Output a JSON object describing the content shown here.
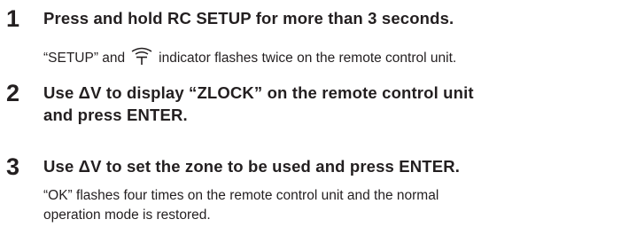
{
  "steps": [
    {
      "number": "1",
      "title": "Press and hold RC SETUP for more than 3 seconds.",
      "desc_part1": "“SETUP” and",
      "desc_icon": "remote-signal-indicator-icon",
      "desc_part2": "indicator flashes twice on the remote control unit."
    },
    {
      "number": "2",
      "title_line1": "Use ΔV to display “ZLOCK” on the remote control unit",
      "title_line2": "and press ENTER."
    },
    {
      "number": "3",
      "title": "Use ΔV to set the zone to be used and press ENTER.",
      "desc_line1": "“OK” flashes four times on the remote control unit and the normal",
      "desc_line2": "operation mode is restored."
    }
  ]
}
